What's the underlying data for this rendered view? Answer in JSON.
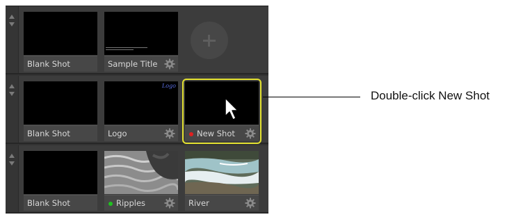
{
  "rows": [
    {
      "shots": [
        {
          "label": "Blank Shot",
          "status": null,
          "gear": false,
          "thumb": "black"
        },
        {
          "label": "Sample Title",
          "status": null,
          "gear": true,
          "thumb": "title"
        }
      ],
      "add_button": "plus-icon"
    },
    {
      "shots": [
        {
          "label": "Blank Shot",
          "status": null,
          "gear": false,
          "thumb": "black"
        },
        {
          "label": "Logo",
          "status": null,
          "gear": true,
          "thumb": "logo",
          "thumb_text": "Logo"
        },
        {
          "label": "New Shot",
          "status": "red",
          "gear": true,
          "thumb": "black",
          "selected": true
        }
      ]
    },
    {
      "shots": [
        {
          "label": "Blank Shot",
          "status": null,
          "gear": false,
          "thumb": "black"
        },
        {
          "label": "Ripples",
          "status": "green",
          "gear": true,
          "thumb": "ripples"
        },
        {
          "label": "River",
          "status": null,
          "gear": true,
          "thumb": "river"
        }
      ]
    }
  ],
  "callout": {
    "text": "Double-click New Shot"
  },
  "colors": {
    "panel_bg": "#333333",
    "selection": "#e3e130",
    "live_red": "#e02020",
    "live_green": "#1fc21f",
    "logo_text": "#5a6ee0"
  }
}
